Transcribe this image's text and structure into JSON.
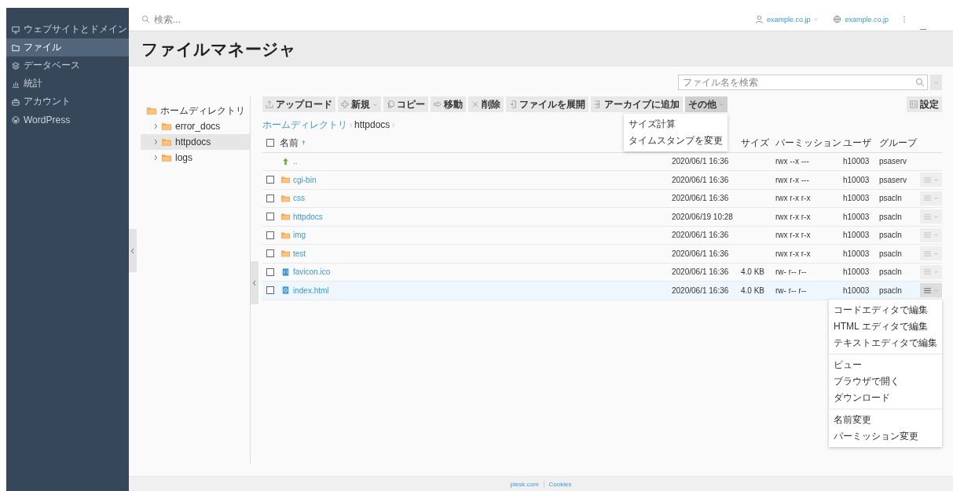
{
  "sidebar": {
    "items": [
      {
        "label": "ウェブサイトとドメイン",
        "selected": false
      },
      {
        "label": "ファイル",
        "selected": true
      },
      {
        "label": "データベース",
        "selected": false
      },
      {
        "label": "統計",
        "selected": false
      },
      {
        "label": "アカウント",
        "selected": false
      },
      {
        "label": "WordPress",
        "selected": false
      }
    ]
  },
  "topbar": {
    "search": {
      "placeholder": "検索..."
    },
    "user": "example.co.jp",
    "domain": "example.co.jp"
  },
  "title": "ファイルマネージャ",
  "file_search": {
    "placeholder": "ファイル名を検索"
  },
  "tree": {
    "label": "ホームディレクトリ",
    "children": [
      {
        "label": "error_docs",
        "selected": false
      },
      {
        "label": "httpdocs",
        "selected": true
      },
      {
        "label": "logs",
        "selected": false
      }
    ]
  },
  "toolbar": {
    "buttons": [
      {
        "label": "アップロード",
        "dropdown": false,
        "open": false
      },
      {
        "label": "新規",
        "dropdown": true,
        "open": false
      },
      {
        "label": "コピー",
        "dropdown": false,
        "open": false
      },
      {
        "label": "移動",
        "dropdown": false,
        "open": false
      },
      {
        "label": "削除",
        "dropdown": false,
        "open": false
      },
      {
        "label": "ファイルを展開",
        "dropdown": false,
        "open": false
      },
      {
        "label": "アーカイブに追加",
        "dropdown": false,
        "open": false
      },
      {
        "label": "その他",
        "dropdown": true,
        "open": true
      }
    ],
    "settings": "設定"
  },
  "more_menu": [
    "サイズ計算",
    "タイムスタンプを変更"
  ],
  "breadcrumb": [
    "ホームディレクトリ",
    "httpdocs"
  ],
  "table": {
    "header": {
      "checked": false,
      "name": "名前",
      "size": "サイズ",
      "permissions": "パーミッション",
      "user": "ユーザ",
      "group": "グループ"
    },
    "rows": [
      {
        "kind": "parent",
        "name": "..",
        "modified": "2020/06/1 16:36",
        "permissions": "rwx --x ---",
        "user": "h10003",
        "group": "psaserv",
        "selected": false
      },
      {
        "kind": "folder",
        "name": "cgi-bin",
        "modified": "2020/06/1 16:36",
        "permissions": "rwx r-x ---",
        "user": "h10003",
        "group": "psaserv",
        "selected": false
      },
      {
        "kind": "folder",
        "name": "css",
        "modified": "2020/06/1 16:36",
        "permissions": "rwx r-x r-x",
        "user": "h10003",
        "group": "psacln",
        "selected": false
      },
      {
        "kind": "folder",
        "name": "httpdocs",
        "modified": "2020/06/19 10:28",
        "permissions": "rwx r-x r-x",
        "user": "h10003",
        "group": "psacln",
        "selected": false
      },
      {
        "kind": "folder",
        "name": "img",
        "modified": "2020/06/1 16:36",
        "permissions": "rwx r-x r-x",
        "user": "h10003",
        "group": "psacln",
        "selected": false
      },
      {
        "kind": "folder",
        "name": "test",
        "modified": "2020/06/1 16:36",
        "permissions": "rwx r-x r-x",
        "user": "h10003",
        "group": "psacln",
        "selected": false
      },
      {
        "kind": "binary",
        "name": "favicon.ico",
        "modified": "2020/06/1 16:36",
        "size": "4.0 KB",
        "permissions": "rw- r-- r--",
        "user": "h10003",
        "group": "psacln",
        "selected": false
      },
      {
        "kind": "html",
        "name": "index.html",
        "modified": "2020/06/1 16:36",
        "size": "4.0 KB",
        "permissions": "rw- r-- r--",
        "user": "h10003",
        "group": "psacln",
        "selected": true
      }
    ]
  },
  "row_menu": [
    [
      "コードエディタで編集",
      "HTML エディタで編集",
      "テキストエディタで編集"
    ],
    [
      "ビュー",
      "ブラウザで開く",
      "ダウンロード"
    ],
    [
      "名前変更",
      "パーミッション変更"
    ]
  ],
  "footer": [
    "plesk.com",
    "Cookies"
  ]
}
